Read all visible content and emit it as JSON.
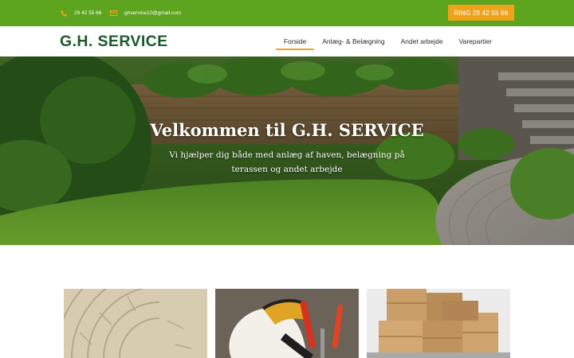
{
  "topbar": {
    "phone": "29 42 55 66",
    "email": "ghservice10@gmail.com",
    "call_button": "RING 29 42 55 66",
    "phone_icon": "phone-icon",
    "email_icon": "envelope-icon"
  },
  "header": {
    "logo": "G.H. SERVICE",
    "nav": [
      {
        "label": "Forside",
        "active": true
      },
      {
        "label": "Anlæg- & Belægning",
        "active": false
      },
      {
        "label": "Andet arbejde",
        "active": false
      },
      {
        "label": "Varepartier",
        "active": false
      }
    ]
  },
  "hero": {
    "title": "Velkommen til G.H. SERVICE",
    "subtitle": "Vi hjælper dig både med anlæg af haven, belægning på terassen og andet arbejde"
  },
  "colors": {
    "topbar_green": "#5da41f",
    "accent_orange": "#f0a31a",
    "logo_green": "#1d5a2b"
  }
}
